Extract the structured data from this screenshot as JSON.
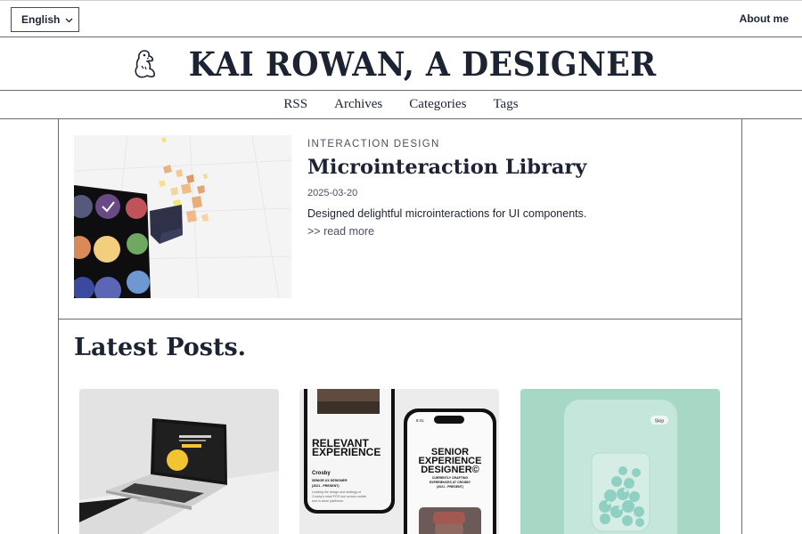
{
  "header": {
    "language": "English",
    "about_link": "About me",
    "site_title": "KAI ROWAN, A DESIGNER"
  },
  "nav": {
    "items": [
      "RSS",
      "Archives",
      "Categories",
      "Tags"
    ]
  },
  "featured": {
    "category": "INTERACTION DESIGN",
    "title": "Microinteraction Library",
    "date": "2025-03-20",
    "description": "Designed delightful microinteractions for UI components.",
    "read_more": ">> read more"
  },
  "latest": {
    "heading": "Latest Posts.",
    "card2": {
      "title1": "RELEVANT",
      "title2": "EXPERIENCE",
      "company": "Crosby",
      "role": "SENIOR UX DESIGNER",
      "dates": "(2021 - PRESENT)",
      "body1": "Leading the design and strategy of",
      "body2": "Crosby's retail POS tool across mobile",
      "body3": "and in-store platforms.",
      "right_time": "9:41",
      "right_t1": "SENIOR",
      "right_t2": "EXPERIENCE",
      "right_t3": "DESIGNER©",
      "right_sub1": "CURRENTLY CRAFTING",
      "right_sub2": "EXPERIENCES AT CROSBY",
      "right_sub3": "(2021 - PRESENT)"
    },
    "card3": {
      "skip": "Skip"
    }
  },
  "colors": {
    "ink": "#1c2433",
    "rule": "#6b6b6b",
    "mint": "#a7d8c6"
  },
  "icons": [
    "chevron-down-icon",
    "dinosaur-logo-icon",
    "checkmark-icon"
  ]
}
